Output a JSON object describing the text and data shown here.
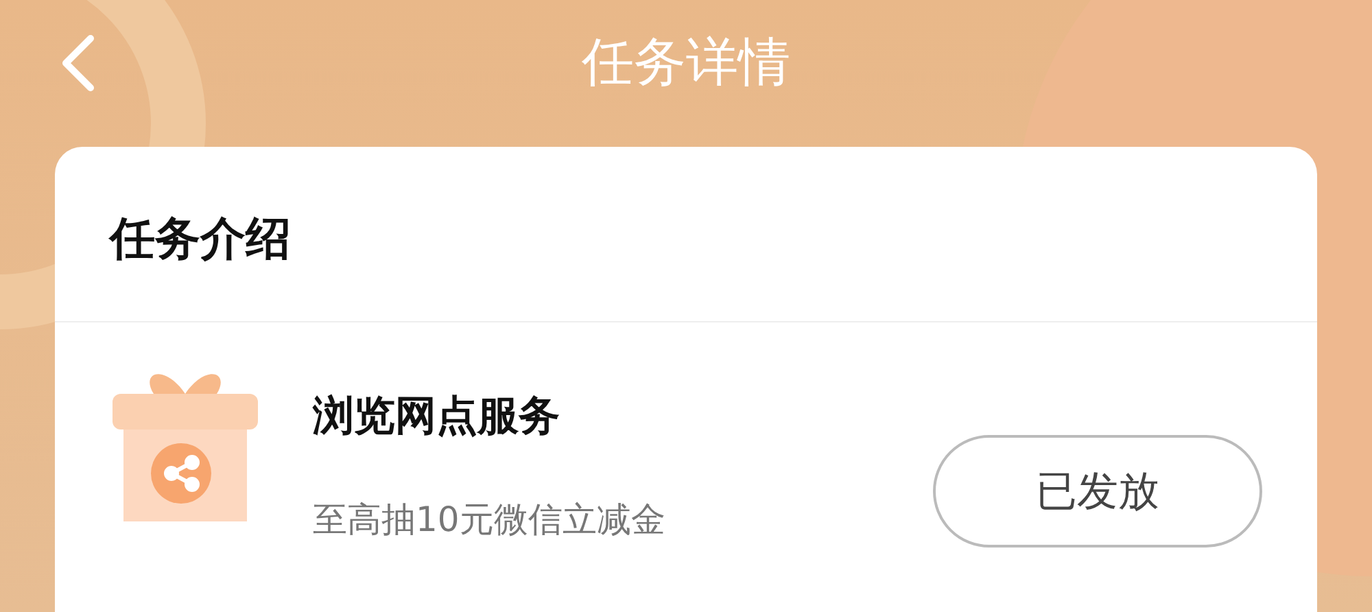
{
  "header": {
    "title": "任务详情"
  },
  "card": {
    "title": "任务介绍",
    "tasks": [
      {
        "name": "浏览网点服务",
        "description": "至高抽10元微信立减金",
        "button": "已发放",
        "disabled": true
      }
    ]
  }
}
